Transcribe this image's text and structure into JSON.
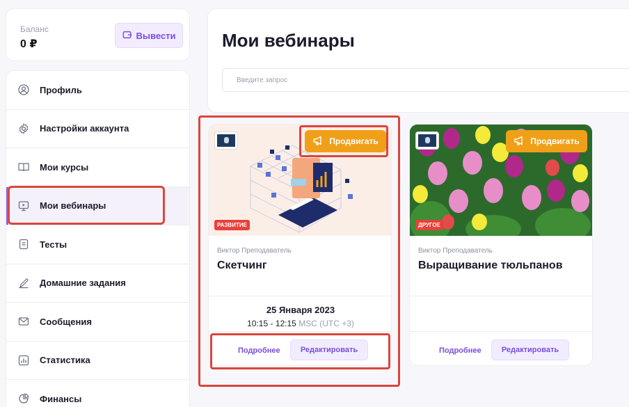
{
  "balance": {
    "label": "Баланс",
    "value": "0 ₽",
    "withdraw_label": "Вывести"
  },
  "sidebar": {
    "items": [
      {
        "label": "Профиль",
        "icon": "user-circle-icon",
        "active": false
      },
      {
        "label": "Настройки аккаунта",
        "icon": "gear-icon",
        "active": false
      },
      {
        "label": "Мои курсы",
        "icon": "book-icon",
        "active": false
      },
      {
        "label": "Мои вебинары",
        "icon": "webinar-screen-icon",
        "active": true
      },
      {
        "label": "Тесты",
        "icon": "document-icon",
        "active": false
      },
      {
        "label": "Домашние задания",
        "icon": "pencil-icon",
        "active": false
      },
      {
        "label": "Сообщения",
        "icon": "mail-icon",
        "active": false
      },
      {
        "label": "Статистика",
        "icon": "bar-chart-icon",
        "active": false
      },
      {
        "label": "Финансы",
        "icon": "pie-chart-icon",
        "active": false
      }
    ]
  },
  "main": {
    "title": "Мои вебинары",
    "search_placeholder": "Введите запрос"
  },
  "cards": [
    {
      "author": "Виктор Преподаватель",
      "title": "Скетчинг",
      "tag": "РАЗВИТИЕ",
      "promote_label": "Продвигать",
      "date": "25 Января 2023",
      "time": "10:15 - 12:15",
      "timezone": "MSC (UTC +3)",
      "more_label": "Подробнее",
      "edit_label": "Редактировать"
    },
    {
      "author": "Виктор Преподаватель",
      "title": "Выращивание тюльпанов",
      "tag": "ДРУГОЕ",
      "promote_label": "Продвигать",
      "more_label": "Подробнее",
      "edit_label": "Редактировать"
    }
  ],
  "colors": {
    "accent": "#7a4de0",
    "promote": "#f0a018",
    "tag": "#e8413b",
    "highlight": "#d9463c"
  }
}
